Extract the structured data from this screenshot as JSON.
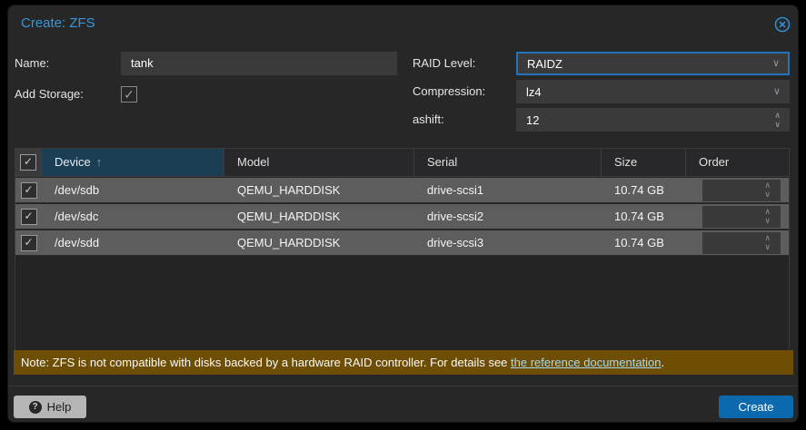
{
  "dialog": {
    "title": "Create: ZFS"
  },
  "form": {
    "name": {
      "label": "Name:",
      "value": "tank"
    },
    "add_storage": {
      "label": "Add Storage:",
      "checked": true
    },
    "raid_level": {
      "label": "RAID Level:",
      "value": "RAIDZ"
    },
    "compression": {
      "label": "Compression:",
      "value": "lz4"
    },
    "ashift": {
      "label": "ashift:",
      "value": "12"
    }
  },
  "table": {
    "columns": {
      "device": "Device",
      "model": "Model",
      "serial": "Serial",
      "size": "Size",
      "order": "Order"
    },
    "sort": {
      "column": "Device",
      "direction": "asc"
    },
    "rows": [
      {
        "checked": true,
        "device": "/dev/sdb",
        "model": "QEMU_HARDDISK",
        "serial": "drive-scsi1",
        "size": "10.74 GB",
        "order": ""
      },
      {
        "checked": true,
        "device": "/dev/sdc",
        "model": "QEMU_HARDDISK",
        "serial": "drive-scsi2",
        "size": "10.74 GB",
        "order": ""
      },
      {
        "checked": true,
        "device": "/dev/sdd",
        "model": "QEMU_HARDDISK",
        "serial": "drive-scsi3",
        "size": "10.74 GB",
        "order": ""
      }
    ]
  },
  "note": {
    "text_before_link": "Note: ZFS is not compatible with disks backed by a hardware RAID controller. For details see ",
    "link_text": "the reference documentation",
    "text_after_link": "."
  },
  "footer": {
    "help_label": "Help",
    "create_label": "Create"
  },
  "icons": {
    "check": "✓",
    "sort_asc": "↑",
    "chevron_down": "∨",
    "spinner_up": "∧",
    "spinner_down": "∨",
    "help": "?"
  },
  "colors": {
    "title_blue": "#3698d8",
    "focus_border": "#2273b8",
    "sorted_header_bg": "#1c3e54",
    "row_bg": "#5d5d5d",
    "note_bg": "#6e4e04",
    "link": "#a5d8f3",
    "create_button": "#0d69ae",
    "help_button": "#b5b5b5",
    "dialog_bg": "#272727",
    "field_bg": "#3a3a3a"
  }
}
